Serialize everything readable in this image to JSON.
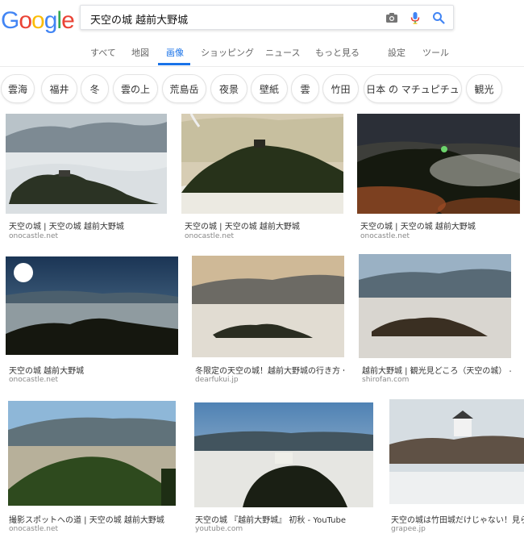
{
  "logo": {
    "letters": [
      "G",
      "o",
      "o",
      "g",
      "l",
      "e"
    ],
    "colors": [
      "#4285F4",
      "#EA4335",
      "#FBBC05",
      "#4285F4",
      "#34A853",
      "#EA4335"
    ]
  },
  "search": {
    "query": "天空の城 越前大野城"
  },
  "tabs": {
    "all": "すべて",
    "maps": "地図",
    "images": "画像",
    "shopping": "ショッピング",
    "news": "ニュース",
    "more": "もっと見る",
    "settings": "設定",
    "tools": "ツール"
  },
  "chips": [
    "雲海",
    "福井",
    "冬",
    "雲の上",
    "荒島岳",
    "夜景",
    "壁紙",
    "雲",
    "竹田",
    "日本 の マチュピチュ",
    "観光"
  ],
  "results": [
    {
      "caption": "天空の城 | 天空の城 越前大野城",
      "source": "onocastle.net"
    },
    {
      "caption": "天空の城 | 天空の城 越前大野城",
      "source": "onocastle.net"
    },
    {
      "caption": "天空の城 | 天空の城 越前大野城",
      "source": "onocastle.net"
    },
    {
      "caption": "天空の城 越前大野城",
      "source": "onocastle.net"
    },
    {
      "caption": "冬限定の天空の城！越前大野城の行き方・...",
      "source": "dearfukui.jp"
    },
    {
      "caption": "越前大野城 | 観光見どころ（天空の城） - ...",
      "source": "shirofan.com"
    },
    {
      "caption": "撮影スポットへの道 | 天空の城 越前大野城",
      "source": "onocastle.net"
    },
    {
      "caption": "天空の城 『越前大野城』 初秋 - YouTube",
      "source": "youtube.com"
    },
    {
      "caption": "天空の城は竹田城だけじゃない！見られる...",
      "source": "grapee.jp"
    }
  ]
}
